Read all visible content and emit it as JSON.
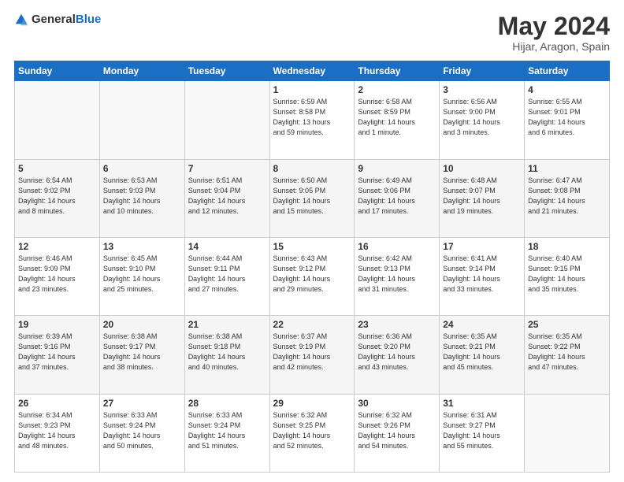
{
  "logo": {
    "general": "General",
    "blue": "Blue"
  },
  "header": {
    "month": "May 2024",
    "location": "Hijar, Aragon, Spain"
  },
  "weekdays": [
    "Sunday",
    "Monday",
    "Tuesday",
    "Wednesday",
    "Thursday",
    "Friday",
    "Saturday"
  ],
  "weeks": [
    [
      {
        "day": "",
        "info": ""
      },
      {
        "day": "",
        "info": ""
      },
      {
        "day": "",
        "info": ""
      },
      {
        "day": "1",
        "info": "Sunrise: 6:59 AM\nSunset: 8:58 PM\nDaylight: 13 hours\nand 59 minutes."
      },
      {
        "day": "2",
        "info": "Sunrise: 6:58 AM\nSunset: 8:59 PM\nDaylight: 14 hours\nand 1 minute."
      },
      {
        "day": "3",
        "info": "Sunrise: 6:56 AM\nSunset: 9:00 PM\nDaylight: 14 hours\nand 3 minutes."
      },
      {
        "day": "4",
        "info": "Sunrise: 6:55 AM\nSunset: 9:01 PM\nDaylight: 14 hours\nand 6 minutes."
      }
    ],
    [
      {
        "day": "5",
        "info": "Sunrise: 6:54 AM\nSunset: 9:02 PM\nDaylight: 14 hours\nand 8 minutes."
      },
      {
        "day": "6",
        "info": "Sunrise: 6:53 AM\nSunset: 9:03 PM\nDaylight: 14 hours\nand 10 minutes."
      },
      {
        "day": "7",
        "info": "Sunrise: 6:51 AM\nSunset: 9:04 PM\nDaylight: 14 hours\nand 12 minutes."
      },
      {
        "day": "8",
        "info": "Sunrise: 6:50 AM\nSunset: 9:05 PM\nDaylight: 14 hours\nand 15 minutes."
      },
      {
        "day": "9",
        "info": "Sunrise: 6:49 AM\nSunset: 9:06 PM\nDaylight: 14 hours\nand 17 minutes."
      },
      {
        "day": "10",
        "info": "Sunrise: 6:48 AM\nSunset: 9:07 PM\nDaylight: 14 hours\nand 19 minutes."
      },
      {
        "day": "11",
        "info": "Sunrise: 6:47 AM\nSunset: 9:08 PM\nDaylight: 14 hours\nand 21 minutes."
      }
    ],
    [
      {
        "day": "12",
        "info": "Sunrise: 6:46 AM\nSunset: 9:09 PM\nDaylight: 14 hours\nand 23 minutes."
      },
      {
        "day": "13",
        "info": "Sunrise: 6:45 AM\nSunset: 9:10 PM\nDaylight: 14 hours\nand 25 minutes."
      },
      {
        "day": "14",
        "info": "Sunrise: 6:44 AM\nSunset: 9:11 PM\nDaylight: 14 hours\nand 27 minutes."
      },
      {
        "day": "15",
        "info": "Sunrise: 6:43 AM\nSunset: 9:12 PM\nDaylight: 14 hours\nand 29 minutes."
      },
      {
        "day": "16",
        "info": "Sunrise: 6:42 AM\nSunset: 9:13 PM\nDaylight: 14 hours\nand 31 minutes."
      },
      {
        "day": "17",
        "info": "Sunrise: 6:41 AM\nSunset: 9:14 PM\nDaylight: 14 hours\nand 33 minutes."
      },
      {
        "day": "18",
        "info": "Sunrise: 6:40 AM\nSunset: 9:15 PM\nDaylight: 14 hours\nand 35 minutes."
      }
    ],
    [
      {
        "day": "19",
        "info": "Sunrise: 6:39 AM\nSunset: 9:16 PM\nDaylight: 14 hours\nand 37 minutes."
      },
      {
        "day": "20",
        "info": "Sunrise: 6:38 AM\nSunset: 9:17 PM\nDaylight: 14 hours\nand 38 minutes."
      },
      {
        "day": "21",
        "info": "Sunrise: 6:38 AM\nSunset: 9:18 PM\nDaylight: 14 hours\nand 40 minutes."
      },
      {
        "day": "22",
        "info": "Sunrise: 6:37 AM\nSunset: 9:19 PM\nDaylight: 14 hours\nand 42 minutes."
      },
      {
        "day": "23",
        "info": "Sunrise: 6:36 AM\nSunset: 9:20 PM\nDaylight: 14 hours\nand 43 minutes."
      },
      {
        "day": "24",
        "info": "Sunrise: 6:35 AM\nSunset: 9:21 PM\nDaylight: 14 hours\nand 45 minutes."
      },
      {
        "day": "25",
        "info": "Sunrise: 6:35 AM\nSunset: 9:22 PM\nDaylight: 14 hours\nand 47 minutes."
      }
    ],
    [
      {
        "day": "26",
        "info": "Sunrise: 6:34 AM\nSunset: 9:23 PM\nDaylight: 14 hours\nand 48 minutes."
      },
      {
        "day": "27",
        "info": "Sunrise: 6:33 AM\nSunset: 9:24 PM\nDaylight: 14 hours\nand 50 minutes."
      },
      {
        "day": "28",
        "info": "Sunrise: 6:33 AM\nSunset: 9:24 PM\nDaylight: 14 hours\nand 51 minutes."
      },
      {
        "day": "29",
        "info": "Sunrise: 6:32 AM\nSunset: 9:25 PM\nDaylight: 14 hours\nand 52 minutes."
      },
      {
        "day": "30",
        "info": "Sunrise: 6:32 AM\nSunset: 9:26 PM\nDaylight: 14 hours\nand 54 minutes."
      },
      {
        "day": "31",
        "info": "Sunrise: 6:31 AM\nSunset: 9:27 PM\nDaylight: 14 hours\nand 55 minutes."
      },
      {
        "day": "",
        "info": ""
      }
    ]
  ]
}
